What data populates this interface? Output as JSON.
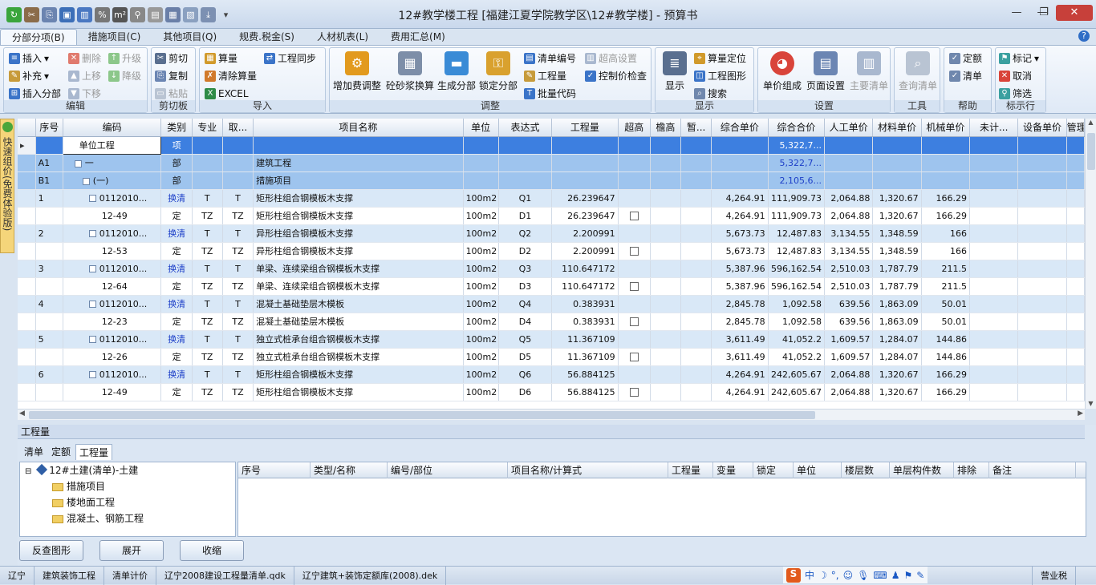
{
  "window": {
    "title": "12#教学楼工程 [福建江夏学院教学区\\12#教学楼] - 预算书",
    "minimize": "—",
    "maximize": "❐",
    "close": "✕",
    "help": "?"
  },
  "tabs": [
    "分部分项(B)",
    "措施项目(C)",
    "其他项目(Q)",
    "规费.税金(S)",
    "人材机表(L)",
    "费用汇总(M)"
  ],
  "ribbon": {
    "edit": {
      "title": "编辑",
      "insert": "插入",
      "delete": "删除",
      "upgrade": "升级",
      "supplement": "补充",
      "move_up": "上移",
      "downgrade": "降级",
      "insert_part": "插入分部",
      "move_down": "下移"
    },
    "clipboard": {
      "title": "剪切板",
      "cut": "剪切",
      "copy": "复制",
      "paste": "粘贴"
    },
    "import": {
      "title": "导入",
      "calc": "算量",
      "sync": "工程同步",
      "clear_calc": "清除算量",
      "excel": "EXCEL"
    },
    "adjust": {
      "title": "调整",
      "fee_adjust": "增加费调整",
      "mortar": "砼砂浆换算",
      "gen_part": "生成分部",
      "lock_part": "锁定分部",
      "code": "清单编号",
      "material": "工程量",
      "batch_code": "批量代码",
      "height": "超高设置",
      "price_check": "控制价检查"
    },
    "display": {
      "title": "显示",
      "show": "显示",
      "locate": "算量定位",
      "graph": "工程图形",
      "search": "搜索"
    },
    "settings": {
      "title": "设置",
      "unit_comp": "单价组成",
      "page_setup": "页面设置",
      "main_list": "主要清单"
    },
    "tools": {
      "title": "工具",
      "query": "查询清单"
    },
    "help": {
      "title": "帮助",
      "quota": "定额",
      "list": "清单"
    },
    "mark": {
      "title": "标示行",
      "mark": "标记",
      "cancel": "取消",
      "filter": "筛选"
    }
  },
  "side_panel": {
    "label": "快速组价(免费体验版)"
  },
  "grid": {
    "columns": [
      "序号",
      "编码",
      "类别",
      "专业",
      "取...",
      "项目名称",
      "单位",
      "表达式",
      "工程量",
      "超高",
      "檐高",
      "暂...",
      "综合单价",
      "综合合价",
      "人工单价",
      "材料单价",
      "机械单价",
      "未计...",
      "设备单价",
      "管理"
    ],
    "rows": [
      {
        "type": "sel",
        "seq": "",
        "code": "单位工程",
        "cat": "项",
        "spec": "",
        "take": "",
        "name": "",
        "unit": "",
        "expr": "",
        "qty": "",
        "hi": false,
        "eave": "",
        "tmp": "",
        "up": "",
        "total": "5,322,7...",
        "lab": "",
        "mat": "",
        "mach": "",
        "uncalc": "",
        "equip": ""
      },
      {
        "type": "grp",
        "seq": "A1",
        "code": "一",
        "cat": "部",
        "spec": "",
        "take": "",
        "name": "建筑工程",
        "unit": "",
        "expr": "",
        "qty": "",
        "hi": false,
        "eave": "",
        "tmp": "",
        "up": "",
        "total": "5,322,7...",
        "lab": "",
        "mat": "",
        "mach": "",
        "uncalc": "",
        "equip": ""
      },
      {
        "type": "grp",
        "seq": "B1",
        "code": "(一)",
        "cat": "部",
        "spec": "",
        "take": "",
        "name": "措施项目",
        "unit": "",
        "expr": "",
        "qty": "",
        "hi": false,
        "eave": "",
        "tmp": "",
        "up": "",
        "total": "2,105,6...",
        "lab": "",
        "mat": "",
        "mach": "",
        "uncalc": "",
        "equip": ""
      },
      {
        "type": "ql",
        "seq": "1",
        "code": "0112010...",
        "cat": "换清",
        "spec": "T",
        "take": "T",
        "name": "矩形柱组合钢模板木支撑",
        "unit": "100m2",
        "expr": "Q1",
        "qty": "26.239647",
        "hi": false,
        "eave": "",
        "tmp": "",
        "up": "4,264.91",
        "total": "111,909.73",
        "lab": "2,064.88",
        "mat": "1,320.67",
        "mach": "166.29",
        "uncalc": "",
        "equip": ""
      },
      {
        "type": "de",
        "seq": "",
        "code": "12-49",
        "cat": "定",
        "spec": "TZ",
        "take": "TZ",
        "name": "矩形柱组合钢模板木支撑",
        "unit": "100m2",
        "expr": "D1",
        "qty": "26.239647",
        "hi": true,
        "eave": "",
        "tmp": "",
        "up": "4,264.91",
        "total": "111,909.73",
        "lab": "2,064.88",
        "mat": "1,320.67",
        "mach": "166.29",
        "uncalc": "",
        "equip": ""
      },
      {
        "type": "ql",
        "seq": "2",
        "code": "0112010...",
        "cat": "换清",
        "spec": "T",
        "take": "T",
        "name": "异形柱组合钢模板木支撑",
        "unit": "100m2",
        "expr": "Q2",
        "qty": "2.200991",
        "hi": false,
        "eave": "",
        "tmp": "",
        "up": "5,673.73",
        "total": "12,487.83",
        "lab": "3,134.55",
        "mat": "1,348.59",
        "mach": "166",
        "uncalc": "",
        "equip": ""
      },
      {
        "type": "de",
        "seq": "",
        "code": "12-53",
        "cat": "定",
        "spec": "TZ",
        "take": "TZ",
        "name": "异形柱组合钢模板木支撑",
        "unit": "100m2",
        "expr": "D2",
        "qty": "2.200991",
        "hi": true,
        "eave": "",
        "tmp": "",
        "up": "5,673.73",
        "total": "12,487.83",
        "lab": "3,134.55",
        "mat": "1,348.59",
        "mach": "166",
        "uncalc": "",
        "equip": ""
      },
      {
        "type": "ql",
        "seq": "3",
        "code": "0112010...",
        "cat": "换清",
        "spec": "T",
        "take": "T",
        "name": "单梁、连续梁组合钢模板木支撑",
        "unit": "100m2",
        "expr": "Q3",
        "qty": "110.647172",
        "hi": false,
        "eave": "",
        "tmp": "",
        "up": "5,387.96",
        "total": "596,162.54",
        "lab": "2,510.03",
        "mat": "1,787.79",
        "mach": "211.5",
        "uncalc": "",
        "equip": ""
      },
      {
        "type": "de",
        "seq": "",
        "code": "12-64",
        "cat": "定",
        "spec": "TZ",
        "take": "TZ",
        "name": "单梁、连续梁组合钢模板木支撑",
        "unit": "100m2",
        "expr": "D3",
        "qty": "110.647172",
        "hi": true,
        "eave": "",
        "tmp": "",
        "up": "5,387.96",
        "total": "596,162.54",
        "lab": "2,510.03",
        "mat": "1,787.79",
        "mach": "211.5",
        "uncalc": "",
        "equip": ""
      },
      {
        "type": "ql",
        "seq": "4",
        "code": "0112010...",
        "cat": "换清",
        "spec": "T",
        "take": "T",
        "name": "混凝土基础垫层木模板",
        "unit": "100m2",
        "expr": "Q4",
        "qty": "0.383931",
        "hi": false,
        "eave": "",
        "tmp": "",
        "up": "2,845.78",
        "total": "1,092.58",
        "lab": "639.56",
        "mat": "1,863.09",
        "mach": "50.01",
        "uncalc": "",
        "equip": ""
      },
      {
        "type": "de",
        "seq": "",
        "code": "12-23",
        "cat": "定",
        "spec": "TZ",
        "take": "TZ",
        "name": "混凝土基础垫层木模板",
        "unit": "100m2",
        "expr": "D4",
        "qty": "0.383931",
        "hi": true,
        "eave": "",
        "tmp": "",
        "up": "2,845.78",
        "total": "1,092.58",
        "lab": "639.56",
        "mat": "1,863.09",
        "mach": "50.01",
        "uncalc": "",
        "equip": ""
      },
      {
        "type": "ql",
        "seq": "5",
        "code": "0112010...",
        "cat": "换清",
        "spec": "T",
        "take": "T",
        "name": "独立式桩承台组合钢模板木支撑",
        "unit": "100m2",
        "expr": "Q5",
        "qty": "11.367109",
        "hi": false,
        "eave": "",
        "tmp": "",
        "up": "3,611.49",
        "total": "41,052.2",
        "lab": "1,609.57",
        "mat": "1,284.07",
        "mach": "144.86",
        "uncalc": "",
        "equip": ""
      },
      {
        "type": "de",
        "seq": "",
        "code": "12-26",
        "cat": "定",
        "spec": "TZ",
        "take": "TZ",
        "name": "独立式桩承台组合钢模板木支撑",
        "unit": "100m2",
        "expr": "D5",
        "qty": "11.367109",
        "hi": true,
        "eave": "",
        "tmp": "",
        "up": "3,611.49",
        "total": "41,052.2",
        "lab": "1,609.57",
        "mat": "1,284.07",
        "mach": "144.86",
        "uncalc": "",
        "equip": ""
      },
      {
        "type": "ql",
        "seq": "6",
        "code": "0112010...",
        "cat": "换清",
        "spec": "T",
        "take": "T",
        "name": "矩形柱组合钢模板木支撑",
        "unit": "100m2",
        "expr": "Q6",
        "qty": "56.884125",
        "hi": false,
        "eave": "",
        "tmp": "",
        "up": "4,264.91",
        "total": "242,605.67",
        "lab": "2,064.88",
        "mat": "1,320.67",
        "mach": "166.29",
        "uncalc": "",
        "equip": ""
      },
      {
        "type": "de",
        "seq": "",
        "code": "12-49",
        "cat": "定",
        "spec": "TZ",
        "take": "TZ",
        "name": "矩形柱组合钢模板木支撑",
        "unit": "100m2",
        "expr": "D6",
        "qty": "56.884125",
        "hi": true,
        "eave": "",
        "tmp": "",
        "up": "4,264.91",
        "total": "242,605.67",
        "lab": "2,064.88",
        "mat": "1,320.67",
        "mach": "166.29",
        "uncalc": "",
        "equip": ""
      }
    ]
  },
  "bottom": {
    "header": "工程量",
    "tabs": [
      "清单",
      "定额",
      "工程量"
    ],
    "tree": [
      "12#土建(清单)-土建",
      "措施项目",
      "楼地面工程",
      "混凝土、钢筋工程"
    ],
    "columns": [
      "序号",
      "类型/名称",
      "编号/部位",
      "项目名称/计算式",
      "工程量",
      "变量",
      "锁定",
      "单位",
      "楼层数",
      "单层构件数",
      "排除",
      "备注"
    ],
    "buttons": {
      "reverse": "反查图形",
      "expand": "展开",
      "collapse": "收缩"
    }
  },
  "status": {
    "region": "辽宁",
    "type": "建筑装饰工程",
    "pricing": "清单计价",
    "list_lib": "辽宁2008建设工程量清单.qdk",
    "quota_lib": "辽宁建筑+装饰定额库(2008).dek",
    "tax": "营业税",
    "ime_lang": "中"
  }
}
